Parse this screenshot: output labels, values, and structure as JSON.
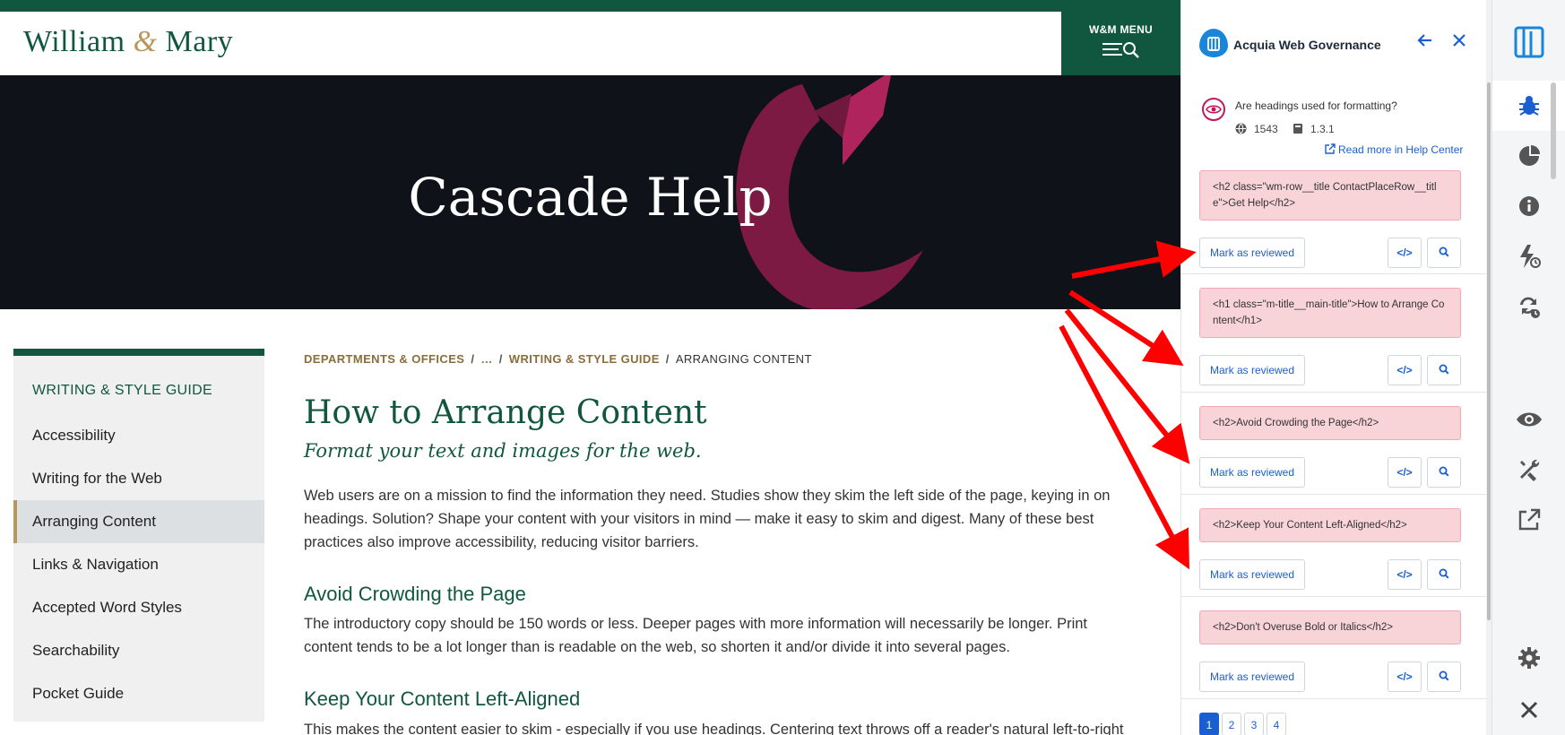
{
  "site": {
    "logo_left": "William",
    "logo_amp": "&",
    "logo_right": "Mary",
    "menu_label": "W&M MENU",
    "hero_title": "Cascade Help",
    "sidebar": {
      "heading": "WRITING & STYLE GUIDE",
      "items": [
        {
          "label": "Accessibility"
        },
        {
          "label": "Writing for the Web"
        },
        {
          "label": "Arranging Content",
          "active": true
        },
        {
          "label": "Links & Navigation"
        },
        {
          "label": "Accepted Word Styles"
        },
        {
          "label": "Searchability"
        },
        {
          "label": "Pocket Guide"
        }
      ]
    },
    "breadcrumb": {
      "items": [
        "DEPARTMENTS & OFFICES",
        "…",
        "WRITING & STYLE GUIDE"
      ],
      "separator": "/",
      "current": "ARRANGING CONTENT"
    },
    "page_title": "How to Arrange Content",
    "page_subtitle": "Format your text and images for the web.",
    "intro": "Web users are on a mission to find the information they need. Studies show they skim the left side of the page, keying in on headings. Solution? Shape your content with your visitors in mind — make it easy to skim and digest. Many of these best practices also improve accessibility, reducing visitor barriers.",
    "section1_title": "Avoid Crowding the Page",
    "section1_text": "The introductory copy should be 150 words or less. Deeper pages with more information will necessarily be longer. Print content tends to be a lot longer than is readable on the web, so shorten it and/or divide it into several pages.",
    "section2_title": "Keep Your Content Left-Aligned",
    "section2_text": "This makes the content easier to skim - especially if you use headings. Centering text throws off a reader's natural left-to-right"
  },
  "panel": {
    "title": "Acquia Web Governance",
    "question": "Are headings used for formatting?",
    "count": "1543",
    "wcag": "1.3.1",
    "help_link": "Read more in Help Center",
    "mark_label": "Mark as reviewed",
    "code_icon": "</>",
    "issues": [
      {
        "code": "<h2 class=\"wm-row__title ContactPlaceRow__title\">Get Help</h2>"
      },
      {
        "code": "<h1 class=\"m-title__main-title\">How to Arrange Content</h1>"
      },
      {
        "code": "<h2>Avoid Crowding the Page</h2>"
      },
      {
        "code": "<h2>Keep Your Content Left-Aligned</h2>"
      },
      {
        "code": "<h2>Don't Overuse Bold or Italics</h2>"
      }
    ],
    "pages": [
      "1",
      "2",
      "3",
      "4"
    ],
    "current_page": "1"
  },
  "rail": {
    "items": [
      "logo-icon",
      "bug-icon",
      "pie-chart-icon",
      "info-icon",
      "lightning-icon",
      "refresh-icon",
      "eye-icon",
      "tools-icon",
      "external-link-icon",
      "gear-icon",
      "close-icon"
    ],
    "active": "bug-icon"
  },
  "colors": {
    "wm_green": "#115740",
    "wm_gold": "#b9975b",
    "hero_bg": "#0f1219",
    "issue_bg": "#f8d4d9",
    "accent_blue": "#1a5fd0",
    "annotation_red": "#ff0000"
  }
}
